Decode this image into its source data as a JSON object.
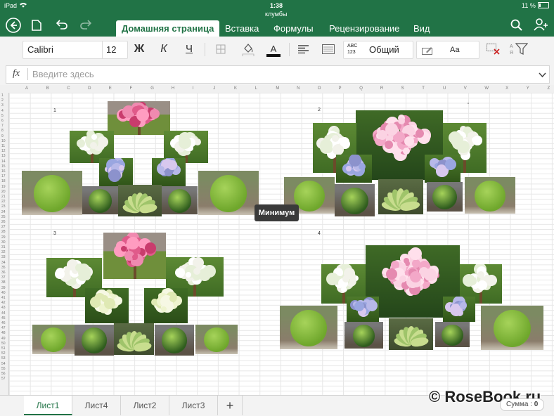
{
  "status_bar": {
    "device": "iPad",
    "time": "1:38",
    "battery": "11 %"
  },
  "header": {
    "file_name": "клумбы",
    "tabs": [
      "Домашняя страница",
      "Вставка",
      "Формулы",
      "Рецензирование",
      "Вид"
    ],
    "active_tab": 0,
    "icons": [
      "back-icon",
      "file-icon",
      "undo-icon",
      "redo-icon",
      "search-icon",
      "share-person-icon"
    ]
  },
  "toolbar": {
    "font_name": "Calibri",
    "font_size": "12",
    "bold": "Ж",
    "italic": "К",
    "underline": "Ч",
    "number_format_icon": "ABC\n123",
    "number_format": "Общий",
    "cell_style": "Аа",
    "font_color": "#cc0000"
  },
  "formula_bar": {
    "fx": "fx",
    "placeholder": "Введите здесь"
  },
  "columns": [
    "A",
    "B",
    "C",
    "D",
    "E",
    "F",
    "G",
    "H",
    "I",
    "J",
    "K",
    "L",
    "M",
    "N",
    "O",
    "P",
    "Q",
    "R",
    "S",
    "T",
    "U",
    "V",
    "W",
    "X",
    "Y",
    "Z"
  ],
  "rows_count": 57,
  "flowerbeds": [
    {
      "label": "1"
    },
    {
      "label": "2"
    },
    {
      "label": "3"
    },
    {
      "label": "4"
    }
  ],
  "tooltip": "Минимум",
  "sheets": [
    "Лист1",
    "Лист4",
    "Лист2",
    "Лист3"
  ],
  "active_sheet": 0,
  "add_sheet": "+",
  "summary": {
    "label": "Сумма :",
    "value": "0"
  },
  "watermark": "© RoseBook.ru",
  "colors": {
    "excel_green": "#217346",
    "toolbar_bg": "#f3f3f3"
  }
}
